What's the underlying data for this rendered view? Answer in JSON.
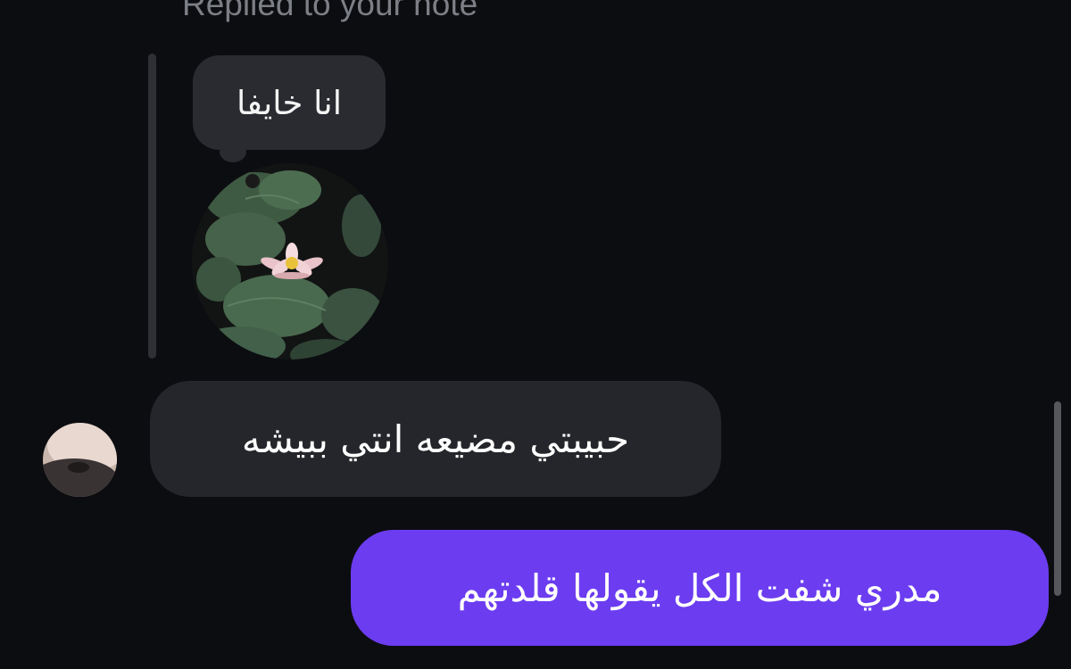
{
  "thread": {
    "reply_header": "Replied to your note"
  },
  "note": {
    "text": "انا خايفا",
    "image_icon": "water-lily-photo"
  },
  "messages": [
    {
      "direction": "incoming",
      "text": "حبيبتي مضيعه انتي ببيشه",
      "avatar": "contact-avatar"
    },
    {
      "direction": "outgoing",
      "text": "مدري شفت الكل يقولها قلدتهم"
    }
  ],
  "colors": {
    "background": "#0c0d11",
    "incoming_bubble": "#25262b",
    "outgoing_bubble": "#6c3cf0",
    "muted_text": "#7d7f86"
  }
}
